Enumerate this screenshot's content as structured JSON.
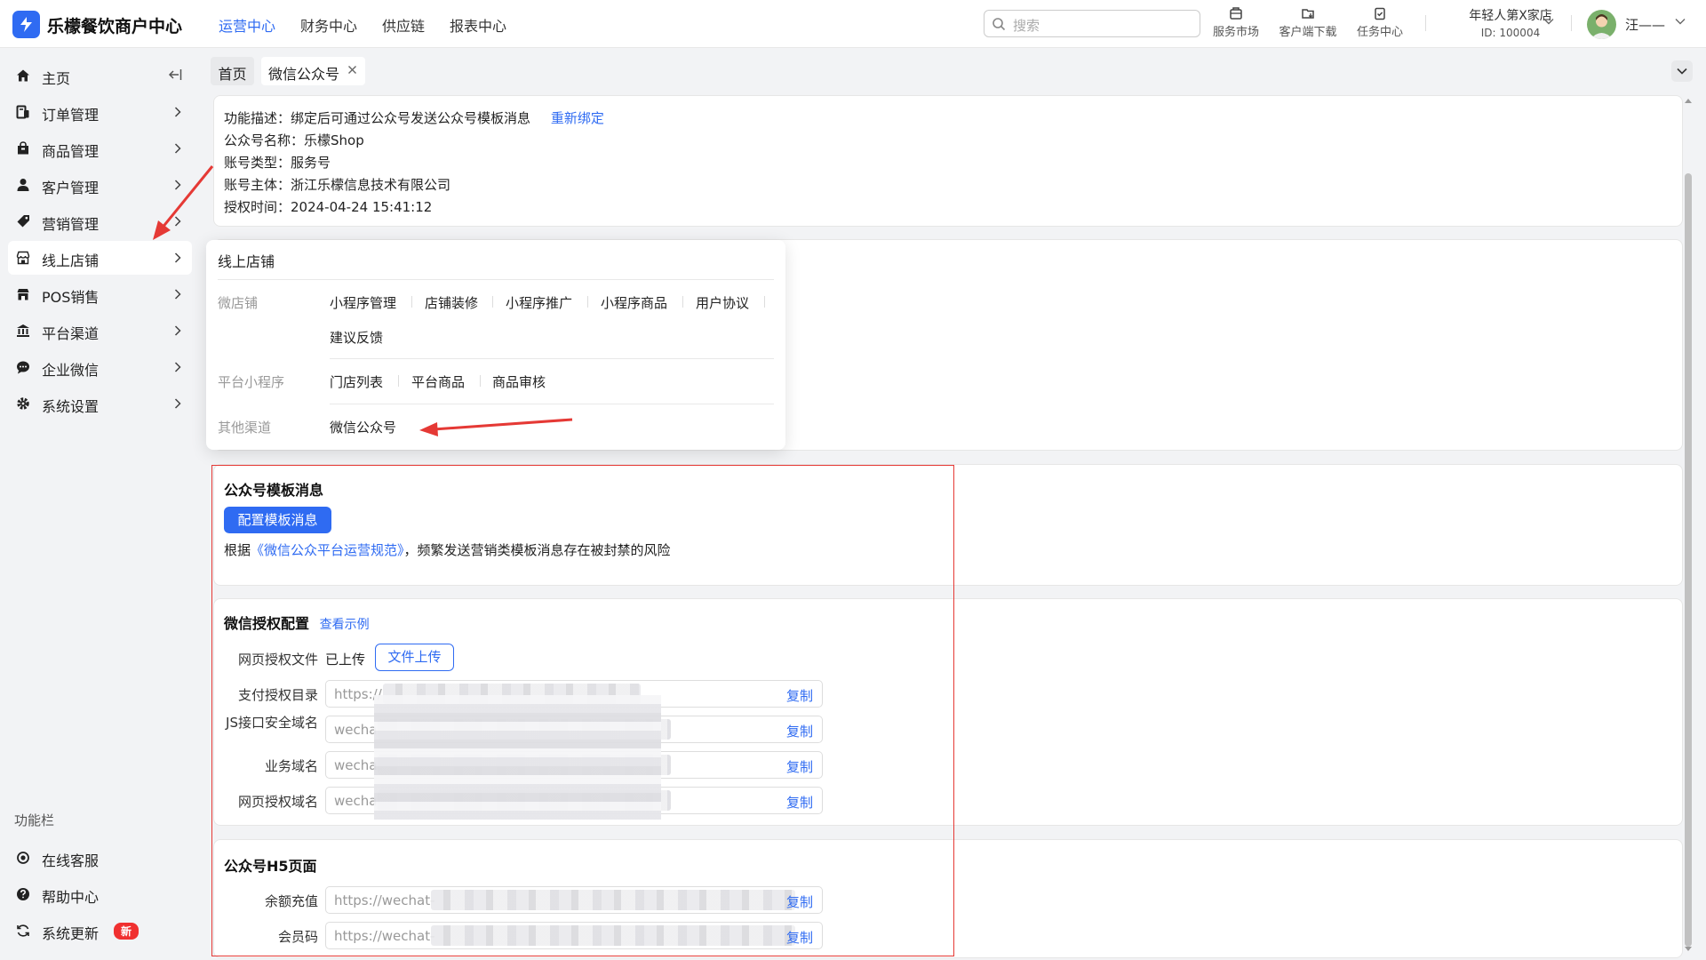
{
  "header": {
    "brand": "乐檬餐饮商户中心",
    "nav": [
      {
        "label": "运营中心",
        "active": true
      },
      {
        "label": "财务中心",
        "active": false
      },
      {
        "label": "供应链",
        "active": false
      },
      {
        "label": "报表中心",
        "active": false
      }
    ],
    "search_placeholder": "搜索",
    "tools": [
      "服务市场",
      "客户端下载",
      "任务中心"
    ],
    "store_name": "年轻人第X家店",
    "store_id": "ID: 100004",
    "username": "汪——"
  },
  "sidebar": {
    "items": [
      {
        "label": "主页",
        "icon": "home-icon"
      },
      {
        "label": "订单管理",
        "icon": "order-icon"
      },
      {
        "label": "商品管理",
        "icon": "product-icon"
      },
      {
        "label": "客户管理",
        "icon": "user-icon"
      },
      {
        "label": "营销管理",
        "icon": "tag-icon"
      },
      {
        "label": "线上店铺",
        "icon": "store-icon"
      },
      {
        "label": "POS销售",
        "icon": "pos-icon"
      },
      {
        "label": "平台渠道",
        "icon": "bank-icon"
      },
      {
        "label": "企业微信",
        "icon": "chat-icon"
      },
      {
        "label": "系统设置",
        "icon": "gear-icon"
      }
    ],
    "section_title": "功能栏",
    "bottom": [
      {
        "label": "在线客服",
        "icon": "service-icon"
      },
      {
        "label": "帮助中心",
        "icon": "help-icon"
      },
      {
        "label": "系统更新",
        "icon": "refresh-icon",
        "badge": "新"
      }
    ]
  },
  "tabs": {
    "home": "首页",
    "current": "微信公众号"
  },
  "info": {
    "desc_label": "功能描述：",
    "desc_value": "绑定后可通过公众号发送公众号模板消息",
    "rebind": "重新绑定",
    "name_line": "公众号名称：乐檬Shop",
    "type_line": "账号类型：服务号",
    "owner_line": "账号主体：浙江乐檬信息技术有限公司",
    "time_line": "授权时间：2024-04-24 15:41:12"
  },
  "dropdown": {
    "title": "线上店铺",
    "groups": [
      {
        "name": "微店铺",
        "links": [
          "小程序管理",
          "店铺装修",
          "小程序推广",
          "小程序商品",
          "用户协议",
          "建议反馈"
        ]
      },
      {
        "name": "平台小程序",
        "links": [
          "门店列表",
          "平台商品",
          "商品审核"
        ]
      },
      {
        "name": "其他渠道",
        "links": [
          "微信公众号"
        ]
      }
    ]
  },
  "template_msg": {
    "title": "公众号模板消息",
    "button": "配置模板消息",
    "note_prefix": "根据",
    "note_link": "《微信公众平台运营规范》",
    "note_suffix": "，频繁发送营销类模板消息存在被封禁的风险"
  },
  "auth_config": {
    "title": "微信授权配置",
    "example_link": "查看示例",
    "file_label": "网页授权文件",
    "file_status": "已上传",
    "upload_button": "文件上传",
    "rows": [
      {
        "label": "支付授权目录",
        "value": "https://",
        "copy": "复制"
      },
      {
        "label": "JS接口安全域名",
        "value": "wechat",
        "copy": "复制"
      },
      {
        "label": "业务域名",
        "value": "wechat",
        "copy": "复制"
      },
      {
        "label": "网页授权域名",
        "value": "wechat",
        "copy": "复制"
      }
    ]
  },
  "h5_pages": {
    "title": "公众号H5页面",
    "rows": [
      {
        "label": "余额充值",
        "value": "https://wechat-",
        "copy": "复制"
      },
      {
        "label": "会员码",
        "value": "https://wechat-",
        "copy": "复制"
      }
    ]
  },
  "colors": {
    "accent": "#2f6bf2",
    "annotation_red": "#e53935",
    "badge_red": "#f03030"
  }
}
